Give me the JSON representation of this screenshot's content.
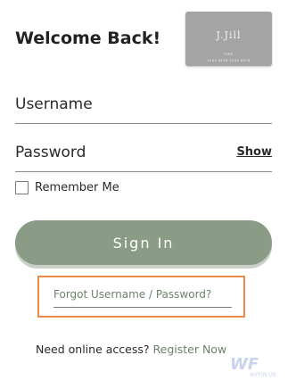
{
  "header": {
    "title": "Welcome Back!"
  },
  "card": {
    "brand": "J.Jill",
    "holder": "FIRS",
    "number": "1234 5678 1234 5678",
    "color": "#a4a4a4"
  },
  "form": {
    "username_label": "Username",
    "password_label": "Password",
    "show_label": "Show",
    "remember_label": "Remember Me",
    "remember_checked": false
  },
  "signin": {
    "label": "Sign In",
    "color": "#8a9c86"
  },
  "forgot": {
    "label": "Forgot Username / Password?",
    "highlight_color": "#ee8a4a"
  },
  "register": {
    "prompt": "Need online access?",
    "link": "Register Now",
    "link_color": "#6c8269"
  },
  "watermark": {
    "text": "WF",
    "subtext": "WYFIN.US"
  }
}
